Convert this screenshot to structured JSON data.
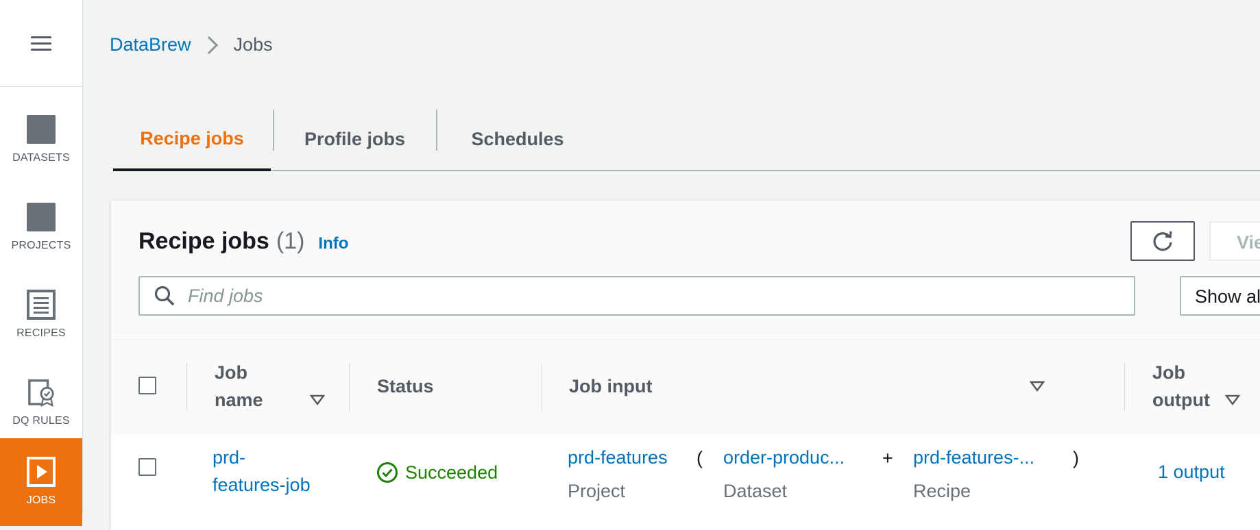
{
  "sidebar": {
    "menu_icon": "hamburger-menu-icon",
    "items": [
      {
        "label": "DATASETS",
        "icon": "dataset-icon",
        "active": false
      },
      {
        "label": "PROJECTS",
        "icon": "project-icon",
        "active": false
      },
      {
        "label": "RECIPES",
        "icon": "recipe-list-icon",
        "active": false
      },
      {
        "label": "DQ RULES",
        "icon": "dq-rules-badge-icon",
        "active": false
      },
      {
        "label": "JOBS",
        "icon": "play-icon",
        "active": true
      }
    ]
  },
  "breadcrumb": {
    "root": "DataBrew",
    "current": "Jobs"
  },
  "tabs": [
    {
      "label": "Recipe jobs",
      "active": true
    },
    {
      "label": "Profile jobs",
      "active": false
    },
    {
      "label": "Schedules",
      "active": false
    }
  ],
  "panel": {
    "title": "Recipe jobs",
    "count": "(1)",
    "info": "Info",
    "view_button": "View",
    "refresh_icon": "refresh-icon",
    "search_placeholder": "Find jobs",
    "filter_select": "Show all"
  },
  "table": {
    "headers": {
      "job_name_line1": "Job",
      "job_name_line2": "name",
      "status": "Status",
      "job_input": "Job input",
      "job_output_line1": "Job",
      "job_output_line2": "output"
    },
    "rows": [
      {
        "job_name_line1": "prd-",
        "job_name_line2": "features-job",
        "status": "Succeeded",
        "project": "prd-features",
        "project_label": "Project",
        "open_paren": "(",
        "dataset": "order-produc...",
        "dataset_label": "Dataset",
        "plus": "+",
        "recipe": "prd-features-...",
        "recipe_label": "Recipe",
        "close_paren": ")",
        "output": "1 output"
      }
    ]
  },
  "colors": {
    "accent": "#ec7211",
    "link": "#0073bb",
    "success": "#1d8102"
  }
}
